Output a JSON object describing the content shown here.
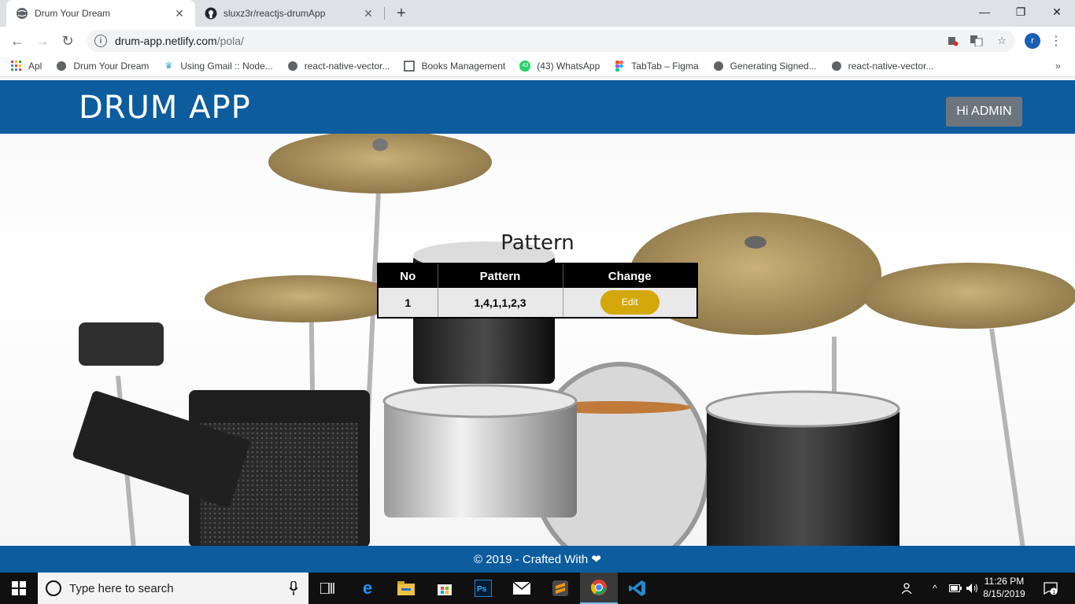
{
  "browser": {
    "tabs": [
      {
        "title": "Drum Your Dream",
        "active": true
      },
      {
        "title": "sluxz3r/reactjs-drumApp",
        "active": false
      }
    ],
    "url_host": "drum-app.netlify.com",
    "url_path": "/pola/",
    "avatar_letter": "r",
    "bookmarks": [
      {
        "label": "Apl",
        "icon": "apps-grid-icon"
      },
      {
        "label": "Drum Your Dream",
        "icon": "globe-icon"
      },
      {
        "label": "Using Gmail :: Node...",
        "icon": "nodemailer-icon"
      },
      {
        "label": "react-native-vector...",
        "icon": "globe-icon"
      },
      {
        "label": "Books Management",
        "icon": "page-icon"
      },
      {
        "label": "(43) WhatsApp",
        "icon": "whatsapp-icon",
        "badge": "43"
      },
      {
        "label": "TabTab – Figma",
        "icon": "figma-icon"
      },
      {
        "label": "Generating Signed...",
        "icon": "globe-icon"
      },
      {
        "label": "react-native-vector...",
        "icon": "globe-icon"
      }
    ]
  },
  "app": {
    "brand": "DRUM APP",
    "user_button": "Hi ADMIN",
    "section_title": "Pattern",
    "table": {
      "headers": [
        "No",
        "Pattern",
        "Change"
      ],
      "rows": [
        {
          "no": "1",
          "pattern": "1,4,1,1,2,3",
          "action": "Edit"
        }
      ]
    },
    "footer": "© 2019 - Crafted With ❤",
    "colors": {
      "header": "#0c5c9e",
      "edit_button": "#d4a80a",
      "user_button": "#6c757d"
    }
  },
  "taskbar": {
    "search_placeholder": "Type here to search",
    "time": "11:26 PM",
    "date": "8/15/2019",
    "notification_count": "1"
  }
}
